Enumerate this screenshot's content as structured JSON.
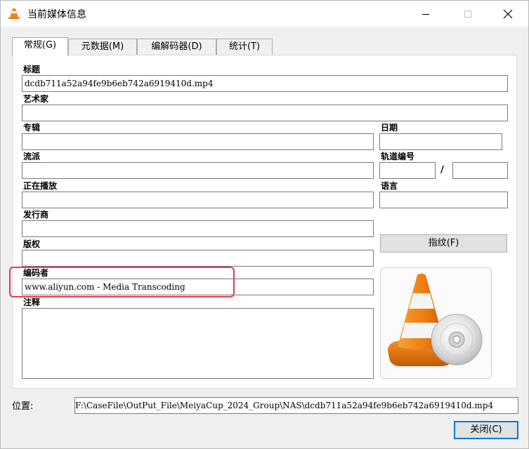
{
  "window": {
    "title": "当前媒体信息",
    "icon": "vlc-cone-icon"
  },
  "tabs": [
    {
      "label": "常规(G)",
      "active": true
    },
    {
      "label": "元数据(M)",
      "active": false
    },
    {
      "label": "编解码器(D)",
      "active": false
    },
    {
      "label": "统计(T)",
      "active": false
    }
  ],
  "general": {
    "title": {
      "label": "标题",
      "value": "dcdb711a52a94fe9b6eb742a6919410d.mp4"
    },
    "artist": {
      "label": "艺术家",
      "value": ""
    },
    "album": {
      "label": "专辑",
      "value": ""
    },
    "date": {
      "label": "日期",
      "value": ""
    },
    "genre": {
      "label": "流派",
      "value": ""
    },
    "track_number": {
      "label": "轨道编号",
      "value": "",
      "total": "",
      "separator": "/"
    },
    "now_playing": {
      "label": "正在播放",
      "value": ""
    },
    "language": {
      "label": "语言",
      "value": ""
    },
    "publisher": {
      "label": "发行商",
      "value": ""
    },
    "copyright": {
      "label": "版权",
      "value": ""
    },
    "encoded_by": {
      "label": "编码者",
      "value": "www.aliyun.com - Media Transcoding"
    },
    "comments": {
      "label": "注释",
      "value": ""
    },
    "fingerprint_button": "指纹(F)",
    "artwork": "vlc-cone-disc-artwork"
  },
  "location": {
    "label": "位置:",
    "value": "F:\\CaseFile\\OutPut_File\\MeiyaCup_2024_Group\\NAS\\dcdb711a52a94fe9b6eb742a6919410d.mp4"
  },
  "close_button": "关闭(C)",
  "colors": {
    "highlight": "#e83b4f",
    "vlc_orange": "#f18a1d",
    "focus_border": "#0078d7"
  }
}
